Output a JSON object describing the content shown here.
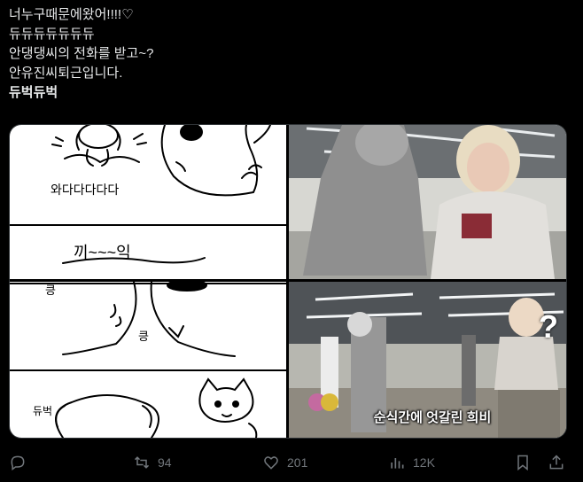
{
  "tweet": {
    "lines": [
      "너누구때문에왔어!!!!♡",
      "듀듀듀듀듀듀듀",
      "안댕댕씨의 전화를 받고~?",
      "안유진씨퇴근입니다.",
      "듀벅듀벅"
    ]
  },
  "media": {
    "panel1": {
      "text": "와다다다다다"
    },
    "panel2": {
      "text": "끼~~~익"
    },
    "panel3": {
      "text1": "킁",
      "text2": "킁"
    },
    "panel4": {
      "text": "듀벅"
    },
    "photo2": {
      "subtitle": "순식간에 엇갈린 희비",
      "marker": "?"
    }
  },
  "actions": {
    "reply": {
      "icon": "reply-icon"
    },
    "retweet": {
      "icon": "retweet-icon",
      "count": "94"
    },
    "like": {
      "icon": "heart-icon",
      "count": "201"
    },
    "views": {
      "icon": "views-icon",
      "count": "12K"
    },
    "bookmark": {
      "icon": "bookmark-icon"
    },
    "share": {
      "icon": "share-icon"
    }
  },
  "colors": {
    "background": "#000000",
    "text": "#e7e9ea",
    "muted": "#71767b"
  }
}
